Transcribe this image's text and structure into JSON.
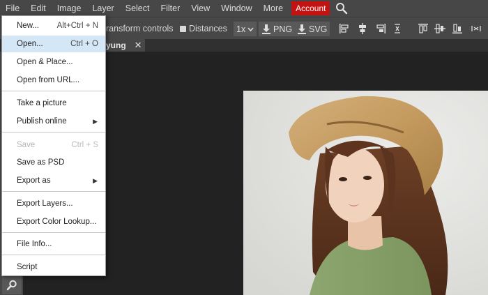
{
  "menubar": {
    "items": [
      "File",
      "Edit",
      "Image",
      "Layer",
      "Select",
      "Filter",
      "View",
      "Window",
      "More"
    ],
    "account_label": "Account",
    "search_icon": "search-icon"
  },
  "toolbar": {
    "transform_controls_label": "ransform controls",
    "distances_label": "Distances",
    "zoom_value": "1x",
    "png_label": "PNG",
    "svg_label": "SVG",
    "align_icons": [
      "align-left-icon",
      "align-center-h-icon",
      "align-right-icon",
      "align-top-icon",
      "align-middle-v-icon",
      "align-bottom-icon",
      "distribute-icon"
    ]
  },
  "tab": {
    "name": "yung",
    "close_glyph": "✕"
  },
  "file_menu": {
    "items": [
      {
        "label": "New...",
        "shortcut": "Alt+Ctrl + N"
      },
      {
        "label": "Open...",
        "shortcut": "Ctrl + O"
      },
      {
        "label": "Open & Place..."
      },
      {
        "label": "Open from URL..."
      },
      {
        "label": "Take a picture"
      },
      {
        "label": "Publish online",
        "submenu": "▶"
      },
      {
        "label": "Save",
        "shortcut": "Ctrl + S"
      },
      {
        "label": "Save as PSD"
      },
      {
        "label": "Export as",
        "submenu": "▶"
      },
      {
        "label": "Export Layers..."
      },
      {
        "label": "Export Color Lookup..."
      },
      {
        "label": "File Info..."
      },
      {
        "label": "Script"
      }
    ]
  },
  "colors": {
    "menubar_bg": "#474747",
    "account_bg": "#c21212",
    "highlight": "#d4e7f7",
    "canvas_bg": "#222222"
  }
}
